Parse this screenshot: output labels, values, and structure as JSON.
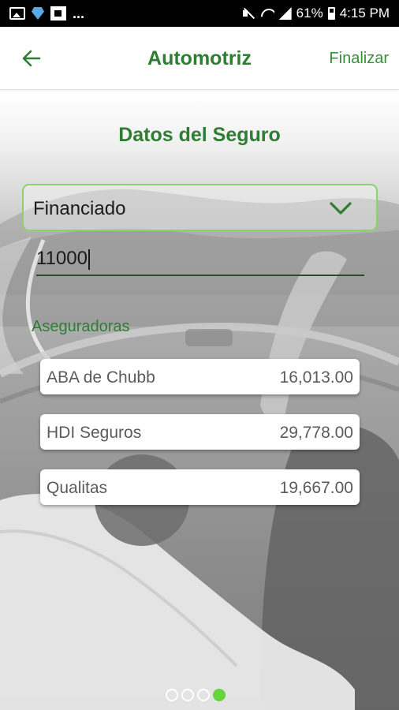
{
  "status_bar": {
    "left_icons": [
      "image-icon",
      "gem-icon",
      "flipboard-icon"
    ],
    "overflow": "...",
    "battery": "61%",
    "time": "4:15 PM"
  },
  "app_bar": {
    "title": "Automotriz",
    "back_icon": "arrow-left-icon",
    "action_label": "Finalizar"
  },
  "form": {
    "section_title": "Datos del Seguro",
    "plan_type": {
      "selected": "Financiado",
      "icon": "chevron-down-icon"
    },
    "amount": {
      "value": "11000"
    }
  },
  "insurers": {
    "label": "Aseguradoras",
    "items": [
      {
        "name": "ABA de Chubb",
        "price": "16,013.00"
      },
      {
        "name": "HDI Seguros",
        "price": "29,778.00"
      },
      {
        "name": "Qualitas",
        "price": "19,667.00"
      }
    ]
  },
  "pager": {
    "total": 4,
    "current": 4
  },
  "colors": {
    "accent": "#2e7d32",
    "select_border": "#8bd36b",
    "active_dot": "#66d43b"
  }
}
